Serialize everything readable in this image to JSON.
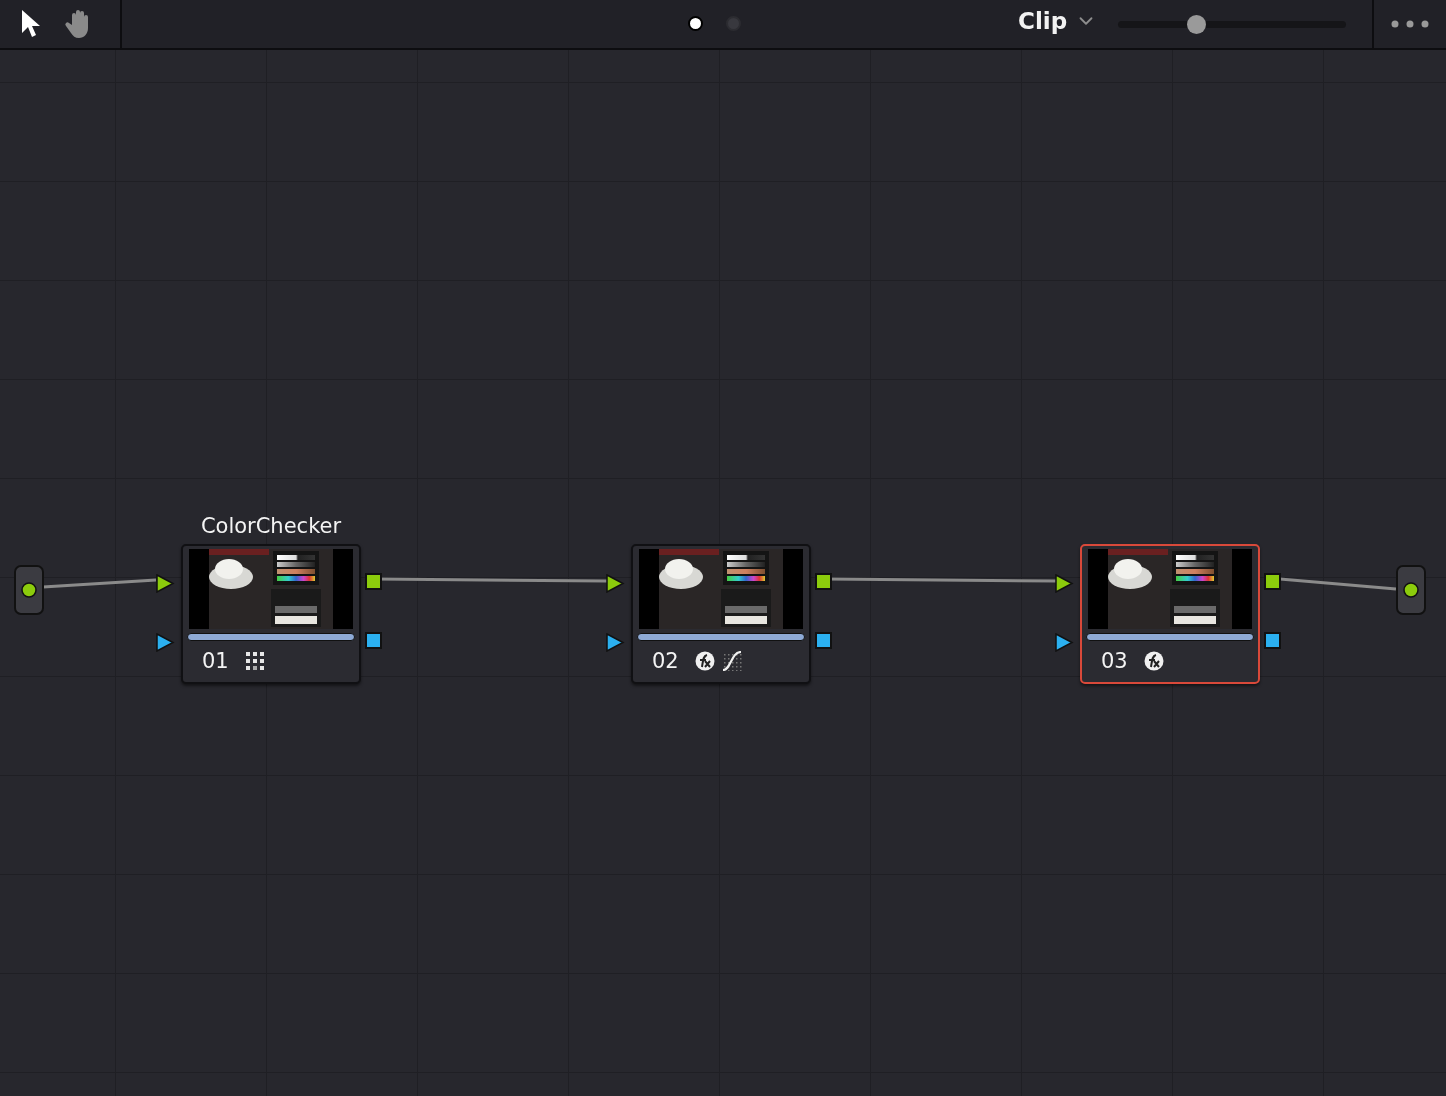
{
  "toolbar": {
    "tools": [
      {
        "kind": "pointer",
        "selected": true
      },
      {
        "kind": "hand",
        "selected": false
      }
    ],
    "pages": [
      {
        "selected": true
      },
      {
        "selected": false
      }
    ],
    "mode": {
      "label": "Clip"
    },
    "zoom": {
      "level": 0.34
    }
  },
  "nodes": [
    {
      "label": "ColorChecker",
      "number": "01",
      "selected": false,
      "badges": [
        {
          "kind": "grid"
        }
      ]
    },
    {
      "number": "02",
      "selected": false,
      "badges": [
        {
          "kind": "fx"
        },
        {
          "kind": "curve"
        }
      ]
    },
    {
      "number": "03",
      "selected": true,
      "badges": [
        {
          "kind": "fx"
        }
      ]
    }
  ]
}
